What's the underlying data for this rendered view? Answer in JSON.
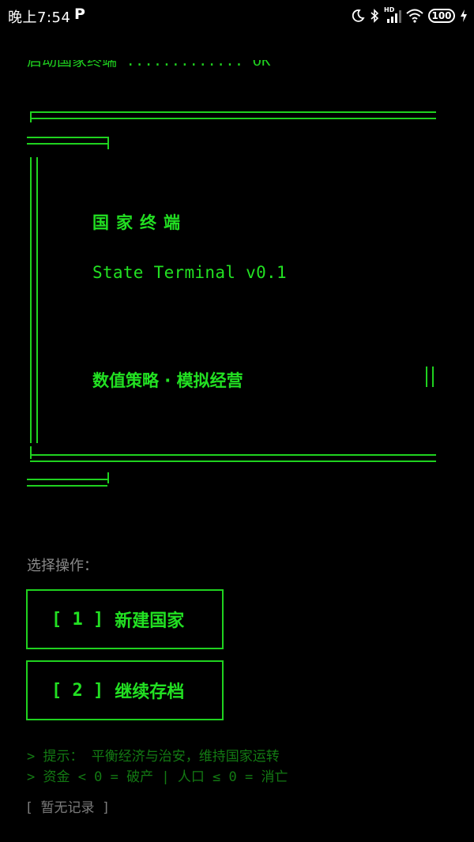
{
  "status_bar": {
    "time": "晚上7:54",
    "app_badge": "P",
    "network": "HD",
    "battery": "100"
  },
  "boot": {
    "line": "启动国家终端 ............. OK"
  },
  "banner": {
    "title_cn": "国家终端",
    "title_en": "State Terminal v0.1",
    "subtitle": "数值策略 · 模拟经营"
  },
  "menu": {
    "prompt": "选择操作：",
    "items": [
      {
        "index": "[ 1 ]",
        "label": "新建国家"
      },
      {
        "index": "[ 2 ]",
        "label": "继续存档"
      }
    ]
  },
  "hints": [
    "> 提示： 平衡经济与治安，维持国家运转",
    "> 资金 < 0 = 破产 | 人口 ≤ 0 = 消亡"
  ],
  "record": "[  暂无记录  ]",
  "colors": {
    "terminal_green": "#22e022",
    "dim_green": "#137a13",
    "label_gray": "#8a8a8a",
    "background": "#000000"
  }
}
